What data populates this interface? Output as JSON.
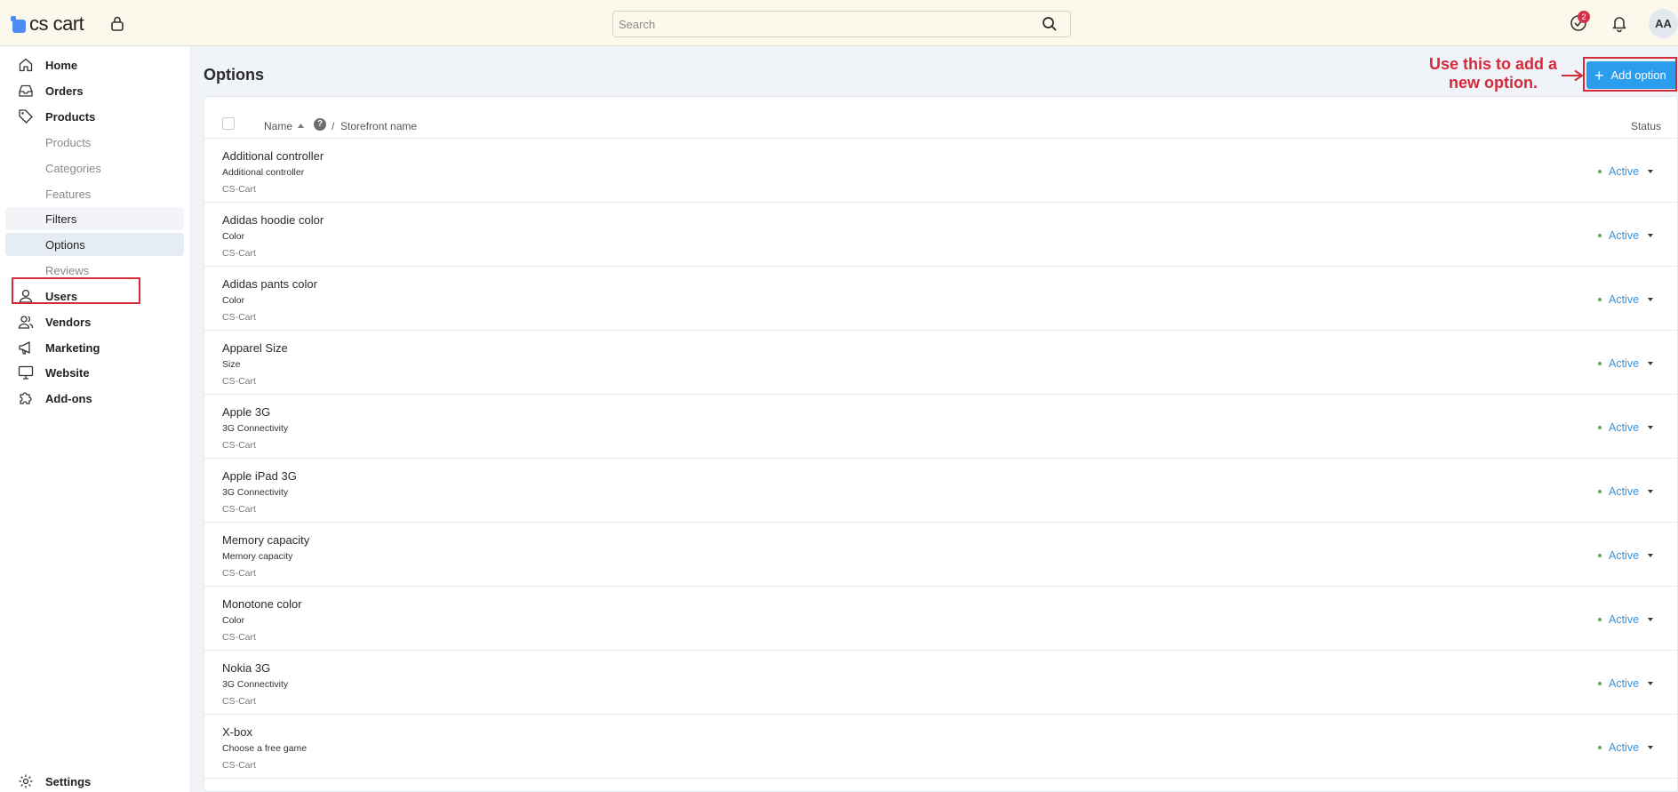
{
  "header": {
    "logo_text": "cs cart",
    "search_placeholder": "Search",
    "notifications_badge": "2",
    "avatar_initials": "AA"
  },
  "sidebar": {
    "items": [
      {
        "label": "Home",
        "icon": "home-icon"
      },
      {
        "label": "Orders",
        "icon": "inbox-icon"
      },
      {
        "label": "Products",
        "icon": "tag-icon"
      },
      {
        "label": "Products",
        "sub": true
      },
      {
        "label": "Categories",
        "sub": true
      },
      {
        "label": "Features",
        "sub": true
      },
      {
        "label": "Filters",
        "sub": true
      },
      {
        "label": "Options",
        "sub": true,
        "active": true
      },
      {
        "label": "Reviews",
        "sub": true
      },
      {
        "label": "Users",
        "icon": "user-icon"
      },
      {
        "label": "Vendors",
        "icon": "users-icon"
      },
      {
        "label": "Marketing",
        "icon": "megaphone-icon"
      },
      {
        "label": "Website",
        "icon": "monitor-icon"
      },
      {
        "label": "Add-ons",
        "icon": "puzzle-icon"
      }
    ],
    "settings_label": "Settings"
  },
  "main": {
    "title": "Options",
    "add_button_label": "Add option",
    "annotation_line1": "Use this to add a",
    "annotation_line2": "new option.",
    "columns": {
      "name": "Name",
      "separator": "/",
      "storefront": "Storefront name",
      "status": "Status"
    },
    "rows": [
      {
        "name": "Additional controller",
        "storefront": "Additional controller",
        "vendor": "CS-Cart",
        "status": "Active"
      },
      {
        "name": "Adidas hoodie color",
        "storefront": "Color",
        "vendor": "CS-Cart",
        "status": "Active"
      },
      {
        "name": "Adidas pants color",
        "storefront": "Color",
        "vendor": "CS-Cart",
        "status": "Active"
      },
      {
        "name": "Apparel Size",
        "storefront": "Size",
        "vendor": "CS-Cart",
        "status": "Active"
      },
      {
        "name": "Apple 3G",
        "storefront": "3G Connectivity",
        "vendor": "CS-Cart",
        "status": "Active"
      },
      {
        "name": "Apple iPad 3G",
        "storefront": "3G Connectivity",
        "vendor": "CS-Cart",
        "status": "Active"
      },
      {
        "name": "Memory capacity",
        "storefront": "Memory capacity",
        "vendor": "CS-Cart",
        "status": "Active"
      },
      {
        "name": "Monotone color",
        "storefront": "Color",
        "vendor": "CS-Cart",
        "status": "Active"
      },
      {
        "name": "Nokia 3G",
        "storefront": "3G Connectivity",
        "vendor": "CS-Cart",
        "status": "Active"
      },
      {
        "name": "X-box",
        "storefront": "Choose a free game",
        "vendor": "CS-Cart",
        "status": "Active"
      }
    ]
  },
  "colors": {
    "accent": "#2b9ded",
    "header_bg": "#fdf8ec",
    "annotation": "#d42b3a",
    "status_active": "#4caf50",
    "status_link": "#3a8fd8"
  }
}
